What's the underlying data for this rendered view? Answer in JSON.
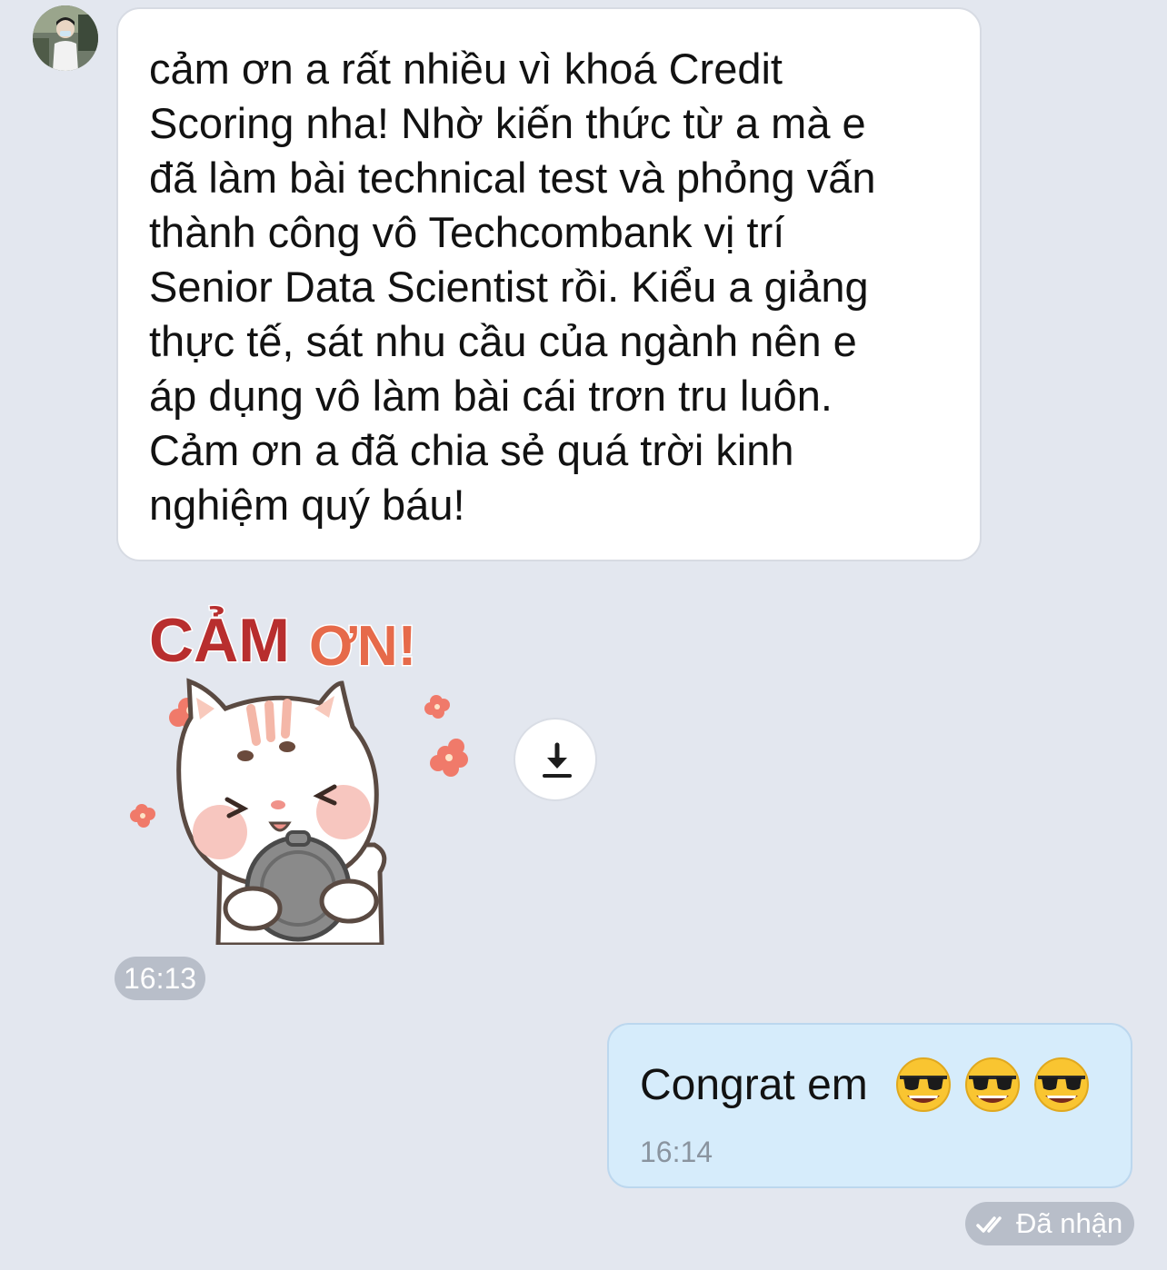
{
  "incoming": {
    "message_text": "cảm ơn a rất nhiều vì khoá Credit\nScoring nha! Nhờ kiến thức từ a mà e\nđã làm bài technical test và phỏng vấn\nthành công vô Techcombank vị trí\nSenior Data Scientist rồi. Kiểu a giảng\nthực tế, sát nhu cầu của ngành nên e\náp dụng vô làm bài cái trơn tru luôn.\nCảm ơn a đã chia sẻ quá trời kinh\nnghiệm quý báu!",
    "sticker_icon": "cat-thank-you-sticker",
    "sticker_text_1": "CẢM",
    "sticker_text_2": "ƠN!",
    "time": "16:13",
    "download_icon": "download-icon"
  },
  "outgoing": {
    "message_text": "Congrat em",
    "emojis": [
      "sunglasses-emoji",
      "sunglasses-emoji",
      "sunglasses-emoji"
    ],
    "time": "16:14",
    "status": "Đã nhận",
    "status_icon": "double-check-icon"
  },
  "colors": {
    "background": "#e3e7ef",
    "incoming_bubble": "#ffffff",
    "outgoing_bubble": "#d6ecfb",
    "pill": "#b8bec9",
    "sticker_red": "#b82e2e",
    "sticker_orange": "#e66a4a"
  }
}
